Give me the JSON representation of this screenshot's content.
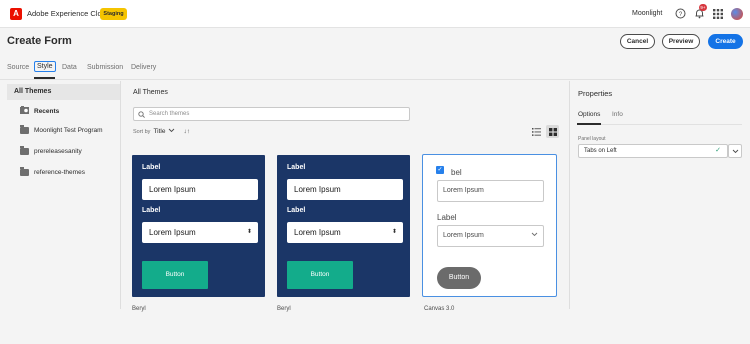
{
  "header": {
    "app_name": "Adobe Experience Cloud",
    "logo_letter": "A",
    "badge": "Staging",
    "org": "Moonlight",
    "notification_count": "9+",
    "icons": [
      "help-icon",
      "bell-icon",
      "apps-grid-icon"
    ]
  },
  "page": {
    "title": "Create Form",
    "cancel_label": "Cancel",
    "preview_label": "Preview",
    "create_label": "Create"
  },
  "tabs": [
    "Source",
    "Style",
    "Data",
    "Submission",
    "Delivery"
  ],
  "active_tab": "Style",
  "left_panel": {
    "header": "All Themes",
    "items": [
      "Recents",
      "Moonlight Test Program",
      "prereleasesanity",
      "reference-themes"
    ]
  },
  "center": {
    "title": "All Themes",
    "search_placeholder": "Search themes",
    "sort_label": "Sort by",
    "sort_value": "Title",
    "sort_order_icon": "↓↑"
  },
  "cards": [
    {
      "name": "Beryl",
      "label1": "Label",
      "input1": "Lorem Ipsum",
      "label2": "Label",
      "select": "Lorem Ipsum",
      "button": "Button"
    },
    {
      "name": "Beryl",
      "label1": "Label",
      "input1": "Lorem Ipsum",
      "label2": "Label",
      "select": "Lorem Ipsum",
      "button": "Button"
    },
    {
      "name": "Canvas 3.0",
      "label1": "bel",
      "input1": "Lorem Ipsum",
      "label2": "Label",
      "select": "Lorem Ipsum",
      "button": "Button"
    }
  ],
  "properties": {
    "title": "Properties",
    "tabs": [
      "Options",
      "Info"
    ],
    "panel_label": "Panel layout",
    "panel_value": "Tabs on Left"
  },
  "colors": {
    "accent": "#1473e6",
    "card_bg": "#1b3667",
    "card_button": "#13ac8b",
    "brand": "#eb1000",
    "badge": "#f5c400"
  }
}
